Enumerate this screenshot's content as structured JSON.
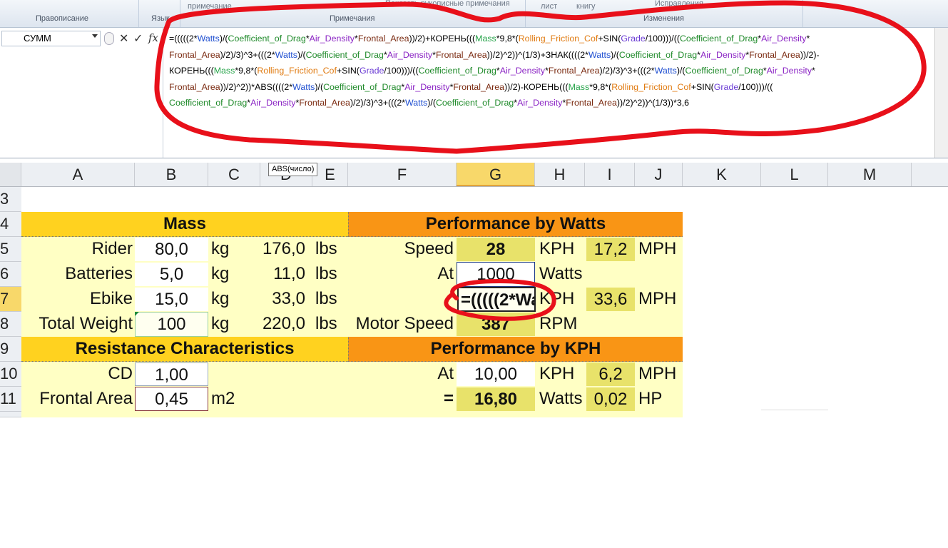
{
  "ribbon": {
    "groups": [
      "Правописание",
      "Язык",
      "Примечания",
      "Изменения"
    ],
    "faint_items": [
      "примечание",
      "Показать рукописные примечания",
      "лист",
      "книгу",
      "Исправления"
    ]
  },
  "formula_bar": {
    "name_box": "СУММ",
    "cancel_symbol": "✕",
    "enter_symbol": "✓",
    "fx_label": "fx",
    "formula_lines": [
      "=(((((2*Watts)/(Coefficient_of_Drag*Air_Density*Frontal_Area))/2)+КОРЕНЬ(((Mass*9,8*(Rolling_Friction_Cof+SIN(Grade/100)))/((Coefficient_of_Drag*Air_Density*",
      "Frontal_Area)/2)/3)^3+(((2*Watts)/(Coefficient_of_Drag*Air_Density*Frontal_Area))/2)^2))^(1/3)+ЗНАК((((2*Watts)/(Coefficient_of_Drag*Air_Density*Frontal_Area))/2)-",
      "КОРЕНЬ(((Mass*9,8*(Rolling_Friction_Cof+SIN(Grade/100)))/((Coefficient_of_Drag*Air_Density*Frontal_Area)/2)/3)^3+(((2*Watts)/(Coefficient_of_Drag*Air_Density*",
      "Frontal_Area))/2)^2))*ABS((((2*Watts)/(Coefficient_of_Drag*Air_Density*Frontal_Area))/2)-КОРЕНЬ(((Mass*9,8*(Rolling_Friction_Cof+SIN(Grade/100)))/((",
      "Coefficient_of_Drag*Air_Density*Frontal_Area)/2)/3)^3+(((2*Watts)/(Coefficient_of_Drag*Air_Density*Frontal_Area))/2)^2))^(1/3))*3,6"
    ]
  },
  "tooltip": "ABS(число)",
  "columns": [
    "A",
    "B",
    "C",
    "D",
    "E",
    "F",
    "G",
    "H",
    "I",
    "J",
    "K",
    "L",
    "M"
  ],
  "rows": [
    "3",
    "4",
    "5",
    "6",
    "7",
    "8",
    "9",
    "10",
    "11"
  ],
  "mass": {
    "header": "Mass",
    "items": [
      {
        "label": "Rider",
        "kg": "80,0",
        "unit": "kg",
        "lbs": "176,0",
        "lunit": "lbs"
      },
      {
        "label": "Batteries",
        "kg": "5,0",
        "unit": "kg",
        "lbs": "11,0",
        "lunit": "lbs"
      },
      {
        "label": "Ebike",
        "kg": "15,0",
        "unit": "kg",
        "lbs": "33,0",
        "lunit": "lbs"
      },
      {
        "label": "Total Weight",
        "kg": "100",
        "unit": "kg",
        "lbs": "220,0",
        "lunit": "lbs"
      }
    ]
  },
  "resistance": {
    "header": "Resistance Characteristics",
    "items": [
      {
        "label": "CD",
        "value": "1,00",
        "unit": ""
      },
      {
        "label": "Frontal Area",
        "value": "0,45",
        "unit": "m2"
      }
    ]
  },
  "watts": {
    "header": "Performance by Watts",
    "speed_label": "Speed",
    "speed_value": "28",
    "kph": "KPH",
    "mph_value": "17,2",
    "mph": "MPH",
    "at_label": "At",
    "watts_value": "1000",
    "watts_unit": "Watts",
    "editing_text": "=(((((2*Wa",
    "row7_kph": "KPH",
    "row7_mph_value": "33,6",
    "row7_mph": "MPH",
    "motor_label": "Motor Speed",
    "motor_value": "387",
    "rpm": "RPM"
  },
  "kph": {
    "header": "Performance by KPH",
    "at_label": "At",
    "at_value": "10,00",
    "kph": "KPH",
    "mph_value": "6,2",
    "mph": "MPH",
    "eq": "=",
    "watts_value": "16,80",
    "watts_unit": "Watts",
    "hp_value": "0,02",
    "hp": "HP"
  },
  "colors": {
    "header_yellow": "#ffd21f",
    "header_orange": "#f99515",
    "panel_fill": "#ffffc4",
    "value_green": "#e8e26a",
    "annotation_red": "#e8101a"
  }
}
